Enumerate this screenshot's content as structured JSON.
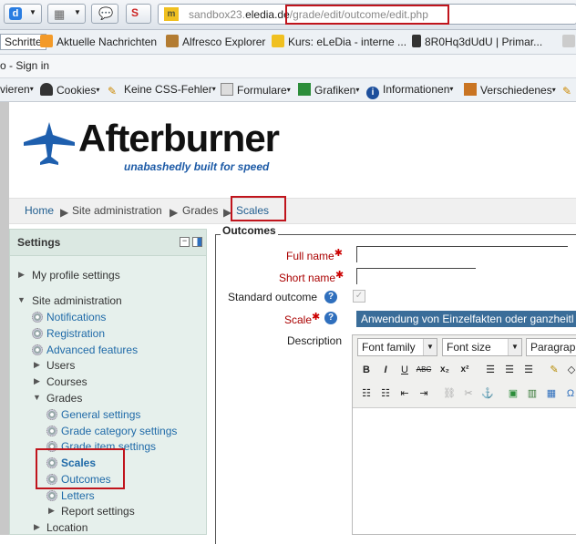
{
  "browser": {
    "url_host_prefix": "sandbox23.",
    "url_domain": "eledia.de",
    "url_path": "/grade/edit/outcome/edit.php",
    "bookmarks": [
      {
        "label": "Schritte"
      },
      {
        "label": "Aktuelle Nachrichten"
      },
      {
        "label": "Alfresco Explorer"
      },
      {
        "label": "Kurs: eLeDia - interne ..."
      },
      {
        "label": "8R0Hq3dUdU | Primar..."
      }
    ],
    "sign_in": "o - Sign in",
    "webdev": [
      {
        "label": "vieren"
      },
      {
        "label": "Cookies"
      },
      {
        "label": "Keine CSS-Fehler"
      },
      {
        "label": "Formulare"
      },
      {
        "label": "Grafiken"
      },
      {
        "label": "Informationen"
      },
      {
        "label": "Verschiedenes"
      }
    ]
  },
  "site": {
    "logo_name": "Afterburner",
    "tagline": "unabashedly built for speed"
  },
  "breadcrumb": [
    "Home",
    "Site administration",
    "Grades",
    "Scales"
  ],
  "settings": {
    "title": "Settings",
    "my_profile": "My profile settings",
    "site_admin": "Site administration",
    "notifications": "Notifications",
    "registration": "Registration",
    "advanced": "Advanced features",
    "users": "Users",
    "courses": "Courses",
    "grades": "Grades",
    "general_settings": "General settings",
    "grade_category_settings": "Grade category settings",
    "grade_item_settings": "Grade item settings",
    "scales": "Scales",
    "outcomes": "Outcomes",
    "letters": "Letters",
    "report_settings": "Report settings",
    "location": "Location"
  },
  "form": {
    "legend": "Outcomes",
    "full_name_label": "Full name",
    "short_name_label": "Short name",
    "standard_outcome_label": "Standard outcome",
    "scale_label": "Scale",
    "scale_value": "Anwendung von Einzelfakten oder ganzheitl",
    "description_label": "Description",
    "font_family": "Font family",
    "font_size": "Font size",
    "paragraph": "Paragraph"
  },
  "colors": {
    "accent_link": "#1f6aa8",
    "highlight_box": "#c0141c",
    "select_bg": "#3a6d99"
  }
}
